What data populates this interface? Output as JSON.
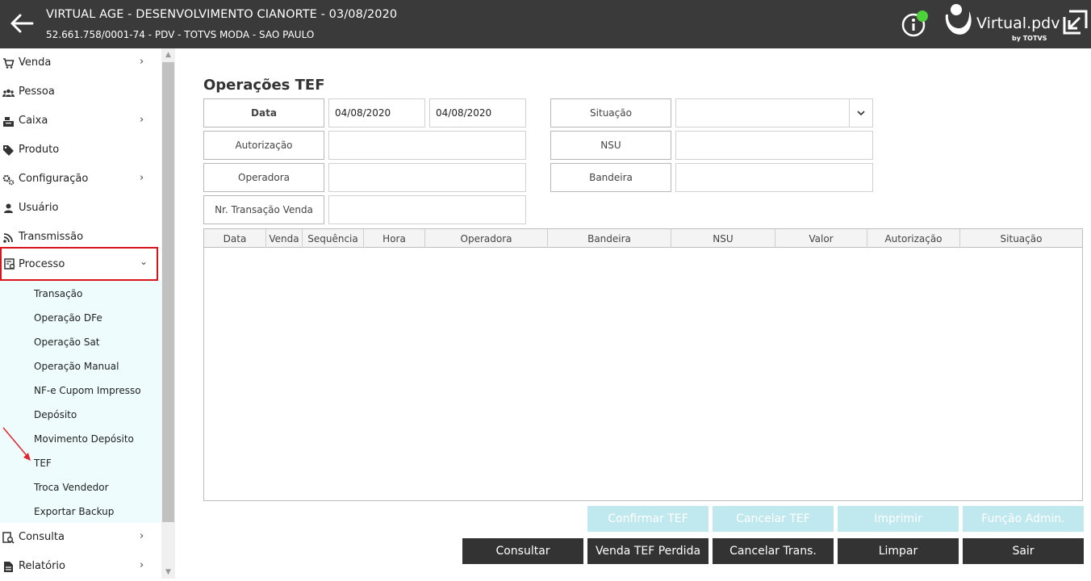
{
  "header": {
    "title": "VIRTUAL AGE - DESENVOLVIMENTO CIANORTE - 03/08/2020",
    "subtitle": "52.661.758/0001-74 - PDV - TOTVS MODA - SAO PAULO",
    "logo_text": "Virtual.pdv",
    "logo_by": "by TOTVS",
    "status_color": "#4cd13c"
  },
  "sidebar": {
    "items": [
      {
        "label": "Venda",
        "icon": "cart-icon",
        "chevron": "›"
      },
      {
        "label": "Pessoa",
        "icon": "people-icon",
        "chevron": ""
      },
      {
        "label": "Caixa",
        "icon": "cash-register-icon",
        "chevron": "›"
      },
      {
        "label": "Produto",
        "icon": "tag-icon",
        "chevron": ""
      },
      {
        "label": "Configuração",
        "icon": "gear-icon",
        "chevron": "›"
      },
      {
        "label": "Usuário",
        "icon": "user-icon",
        "chevron": ""
      },
      {
        "label": "Transmissão",
        "icon": "broadcast-icon",
        "chevron": ""
      },
      {
        "label": "Processo",
        "icon": "process-icon",
        "chevron": "⌄"
      },
      {
        "label": "Consulta",
        "icon": "search-doc-icon",
        "chevron": "›"
      },
      {
        "label": "Relatório",
        "icon": "report-icon",
        "chevron": "›"
      }
    ],
    "submenu": [
      "Transação",
      "Operação DFe",
      "Operação Sat",
      "Operação Manual",
      "NF-e Cupom Impresso",
      "Depósito",
      "Movimento Depósito",
      "TEF",
      "Troca Vendedor",
      "Exportar Backup"
    ],
    "active_color": "#d9121b",
    "submenu_bg": "#eefcfd"
  },
  "main": {
    "title": "Operações TEF",
    "filters": {
      "data_label": "Data",
      "date_from": "04/08/2020",
      "date_to": "04/08/2020",
      "autorizacao_label": "Autorização",
      "autorizacao_value": "",
      "operadora_label": "Operadora",
      "operadora_value": "",
      "nr_transacao_label": "Nr. Transação Venda",
      "nr_transacao_value": "",
      "situacao_label": "Situação",
      "situacao_value": "",
      "nsu_label": "NSU",
      "nsu_value": "",
      "bandeira_label": "Bandeira",
      "bandeira_value": ""
    },
    "table": {
      "columns": [
        "Data",
        "Venda",
        "Sequência",
        "Hora",
        "Operadora",
        "Bandeira",
        "NSU",
        "Valor",
        "Autorização",
        "Situação"
      ],
      "rows": []
    },
    "buttons_top": [
      "Confirmar TEF",
      "Cancelar TEF",
      "Imprimir",
      "Função Admin."
    ],
    "buttons_bottom": [
      "Consultar",
      "Venda TEF Perdida",
      "Cancelar Trans.",
      "Limpar",
      "Sair"
    ],
    "disabled_color": "#bfe9ef",
    "dark_color": "#333333"
  }
}
